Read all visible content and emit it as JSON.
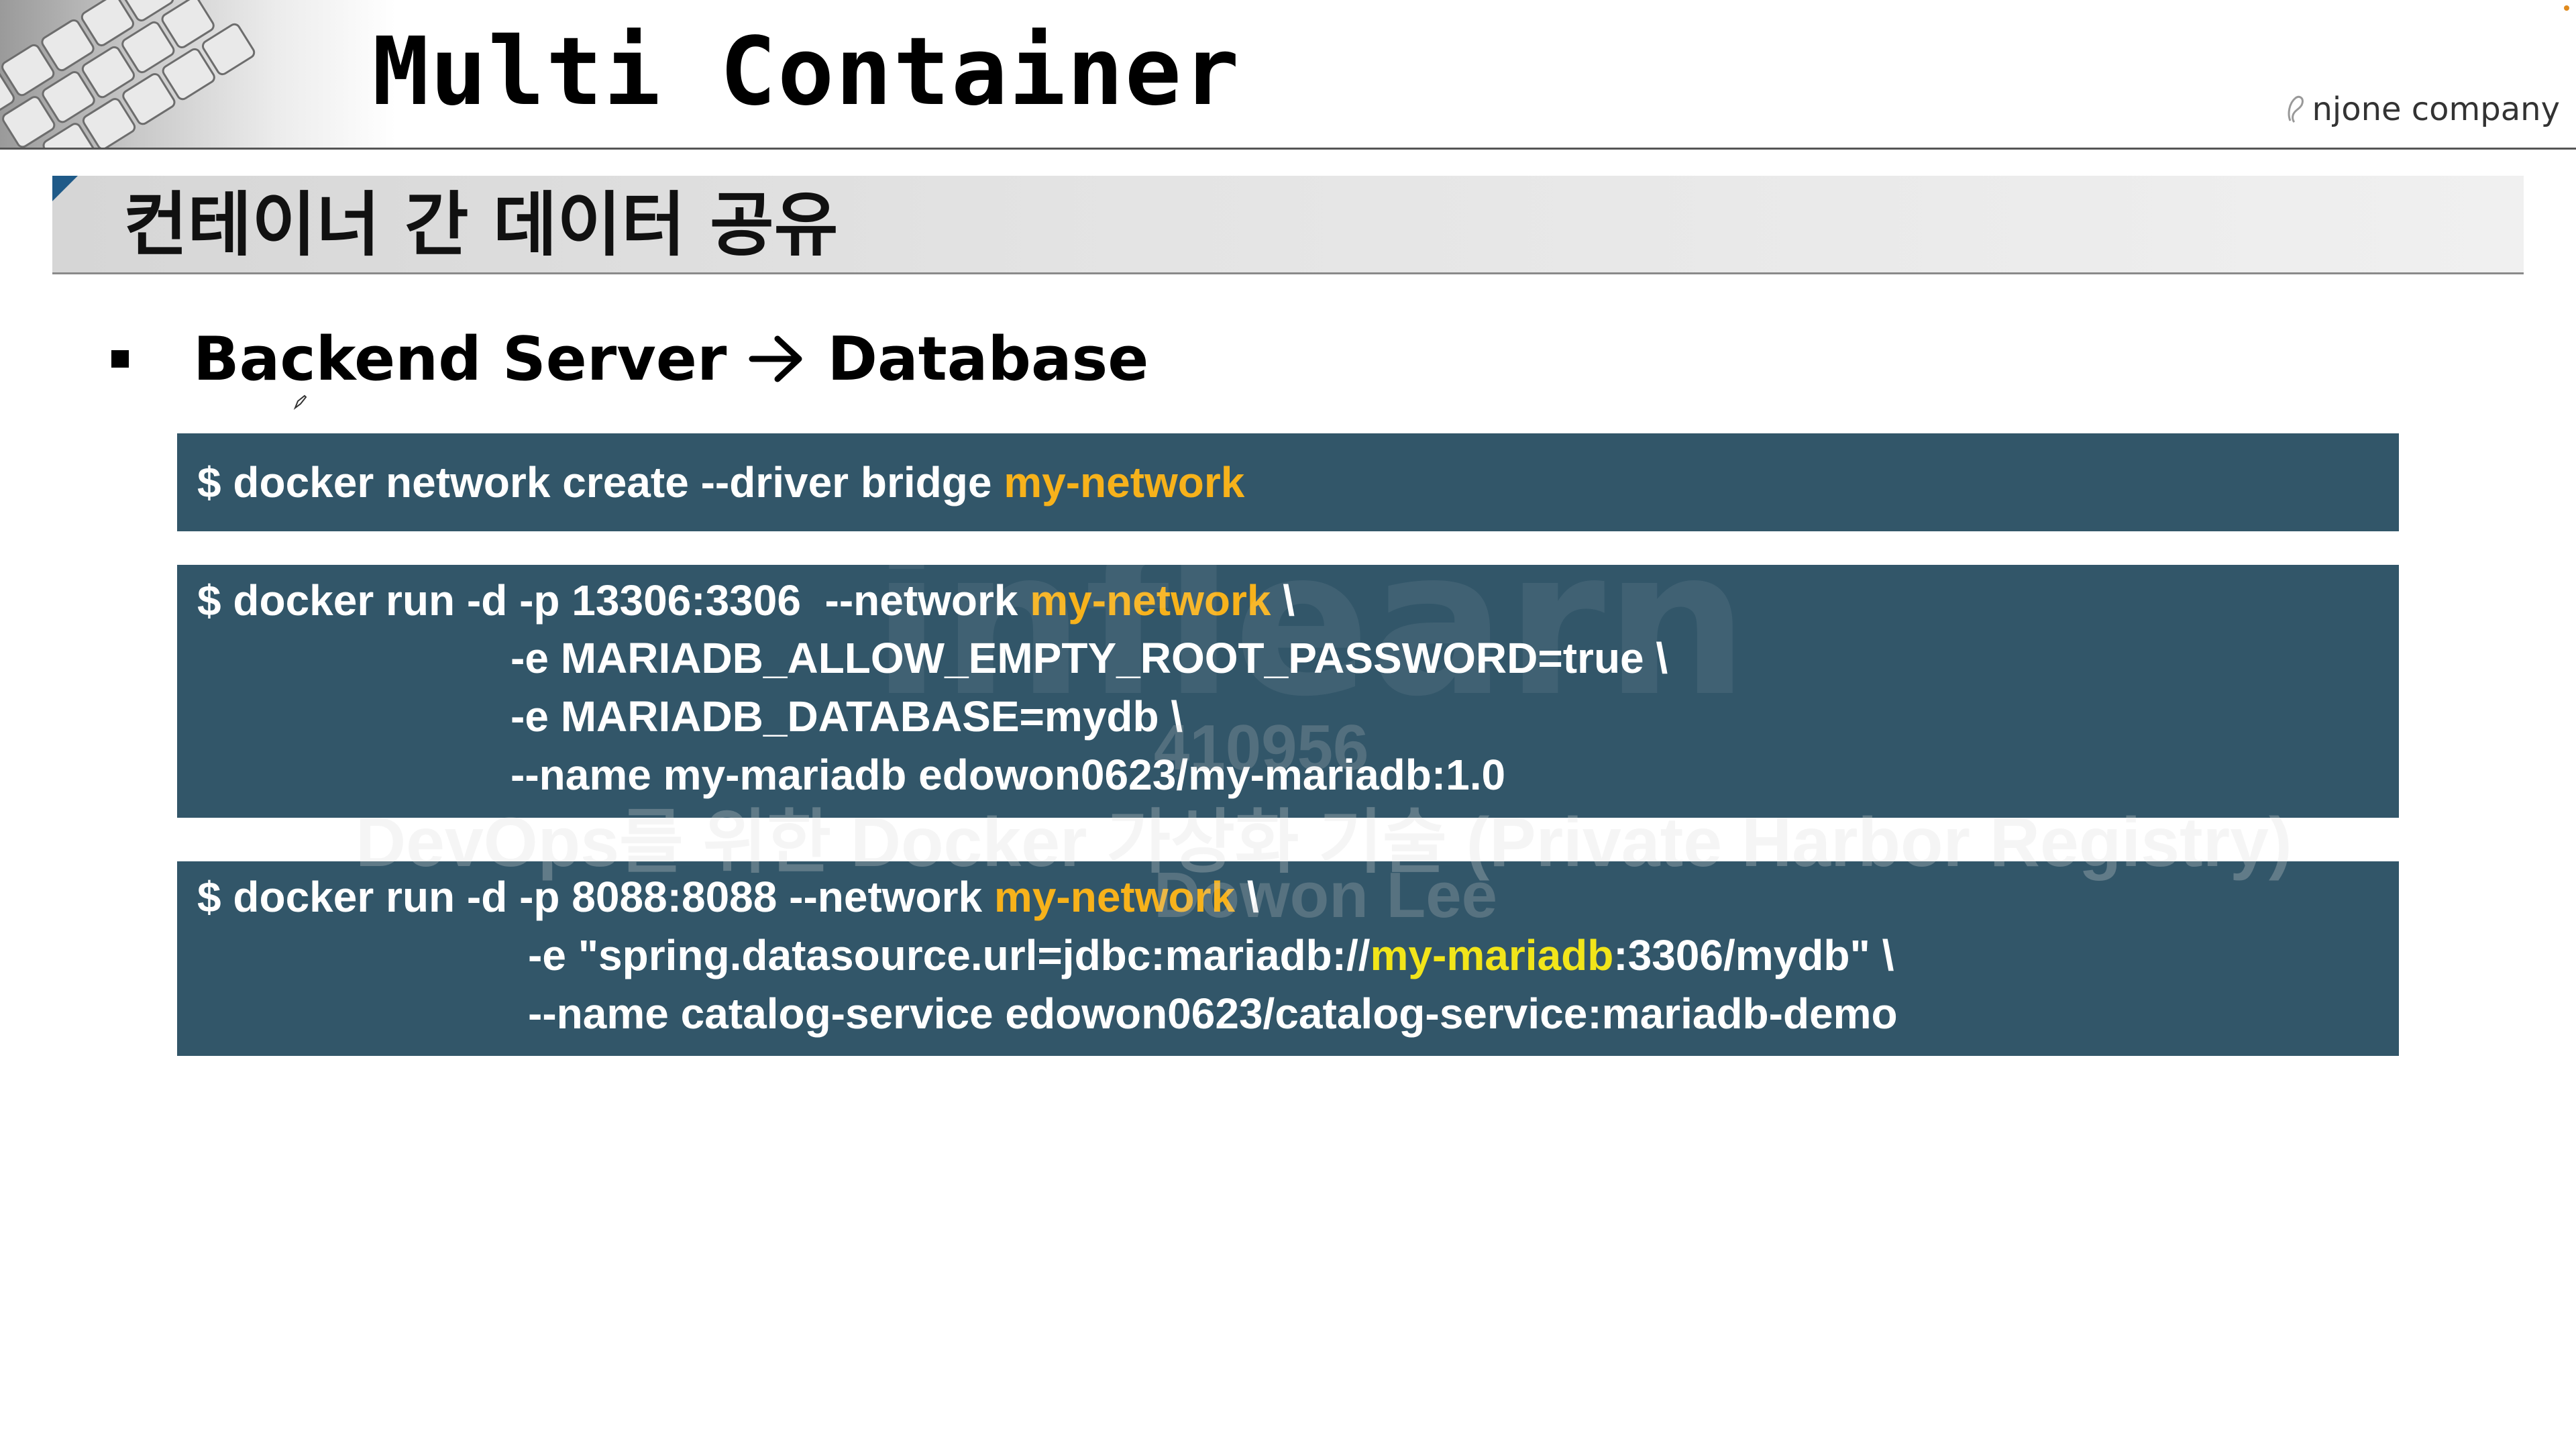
{
  "header": {
    "title": "Multi Container",
    "brand": "njone company"
  },
  "section": {
    "title": "컨테이너 간 데이터 공유"
  },
  "bullet": {
    "left": "Backend Server",
    "right": "Database"
  },
  "colors": {
    "code_bg": "#325669",
    "highlight_orange": "#f7b21b",
    "highlight_yellow": "#f2e51a",
    "accent_blue": "#1f5a88"
  },
  "code_blocks": [
    {
      "lines": [
        {
          "segments": [
            {
              "text": "$ docker network create --driver bridge "
            },
            {
              "text": "my-network",
              "color": "orange"
            }
          ]
        }
      ]
    },
    {
      "lines": [
        {
          "segments": [
            {
              "text": "$ docker run -d -p 13306:3306  --network "
            },
            {
              "text": "my-network",
              "color": "orange"
            },
            {
              "text": " \\"
            }
          ]
        },
        {
          "segments": [
            {
              "text": "-e MARIADB_ALLOW_EMPTY_ROOT_PASSWORD=true \\"
            }
          ]
        },
        {
          "segments": [
            {
              "text": "-e MARIADB_DATABASE=mydb \\"
            }
          ]
        },
        {
          "segments": [
            {
              "text": "--name my-mariadb edowon0623/my-mariadb:1.0"
            }
          ]
        }
      ]
    },
    {
      "lines": [
        {
          "segments": [
            {
              "text": "$ docker run -d -p 8088:8088 --network "
            },
            {
              "text": "my-network",
              "color": "orange"
            },
            {
              "text": " \\"
            }
          ]
        },
        {
          "segments": [
            {
              "text": "-e \"spring.datasource.url=jdbc:mariadb://"
            },
            {
              "text": "my-mariadb",
              "color": "yellow"
            },
            {
              "text": ":3306/mydb\" \\"
            }
          ]
        },
        {
          "segments": [
            {
              "text": "--name catalog-service edowon0623/catalog-service:mariadb-demo"
            }
          ]
        }
      ]
    }
  ],
  "watermark": {
    "logo": "inflearn",
    "id": "410956",
    "course": "DevOps를 위한 Docker 가상화 기술 (Private Harbor Registry)",
    "author": "Dowon Lee"
  }
}
